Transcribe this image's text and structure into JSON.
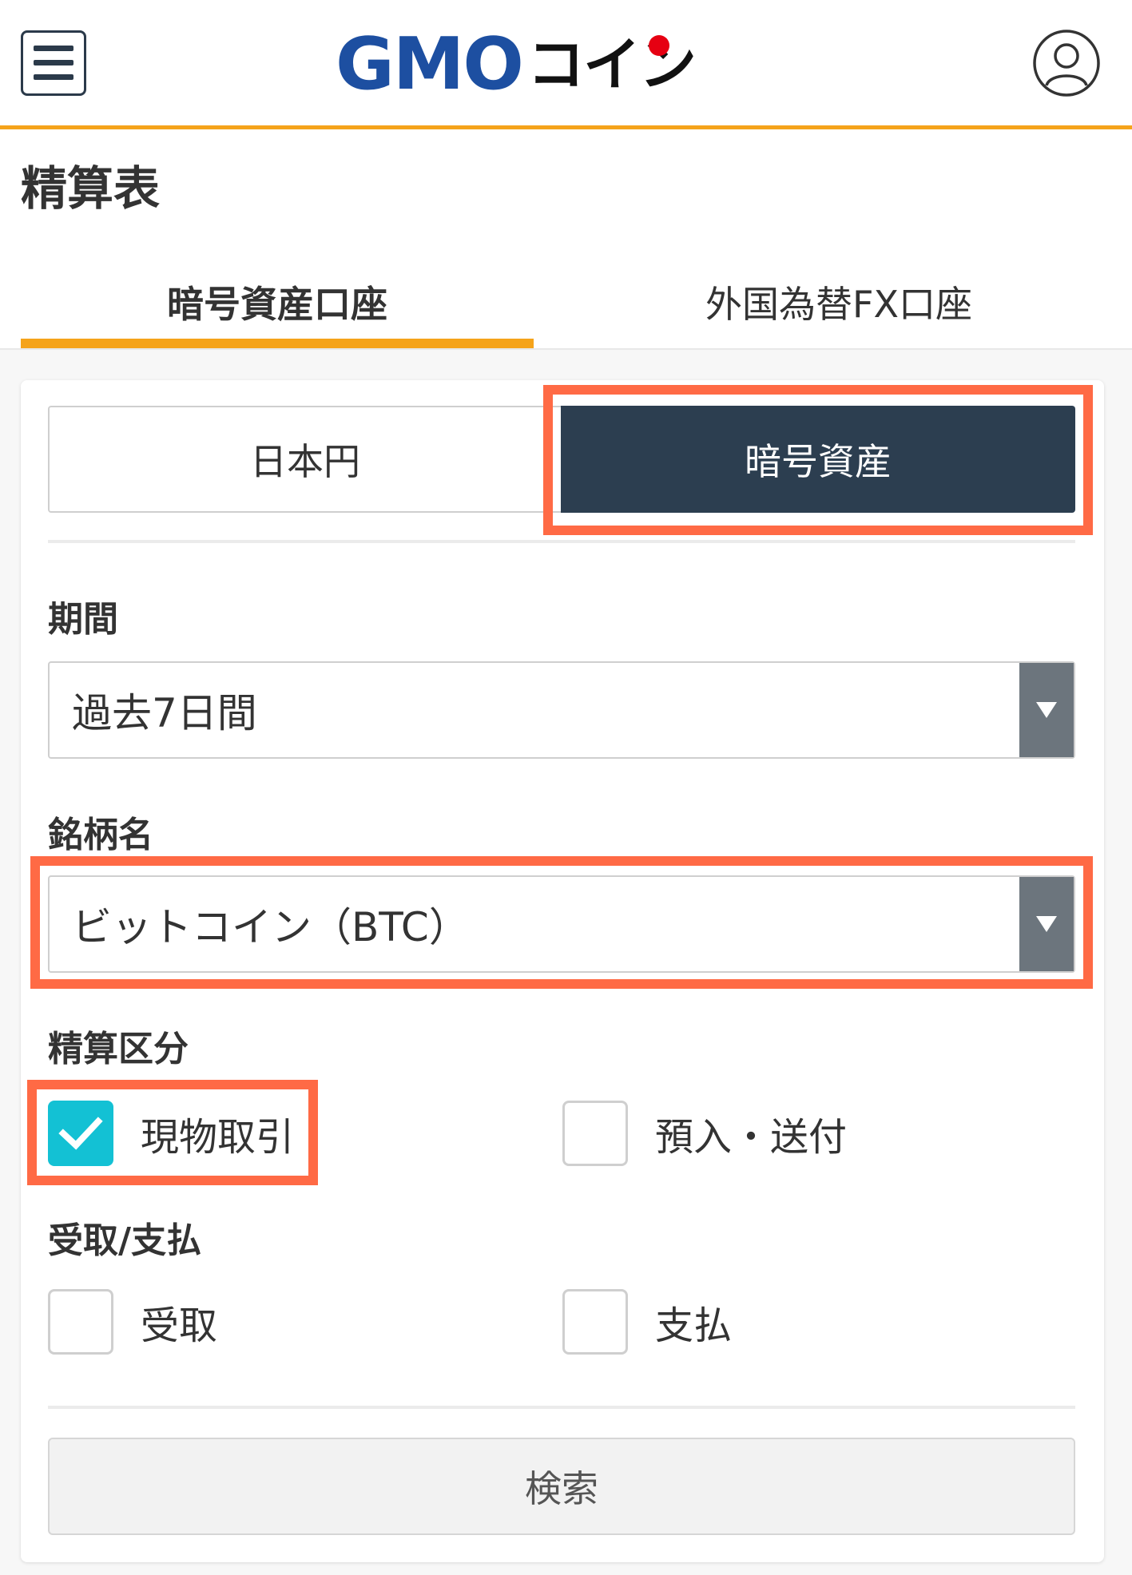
{
  "header": {
    "logo_gmo": "GMO",
    "logo_coin": "コイン"
  },
  "page": {
    "title": "精算表"
  },
  "tabs": {
    "crypto_account": "暗号資産口座",
    "fx_account": "外国為替FX口座"
  },
  "currency_toggle": {
    "jpy": "日本円",
    "crypto": "暗号資産",
    "selected": "crypto"
  },
  "period": {
    "label": "期間",
    "value": "過去7日間"
  },
  "symbol": {
    "label": "銘柄名",
    "value": "ビットコイン（BTC）"
  },
  "settlement_type": {
    "label": "精算区分",
    "options": [
      {
        "label": "現物取引",
        "checked": true
      },
      {
        "label": "預入・送付",
        "checked": false
      }
    ]
  },
  "receipt_payment": {
    "label": "受取/支払",
    "options": [
      {
        "label": "受取",
        "checked": false
      },
      {
        "label": "支払",
        "checked": false
      }
    ]
  },
  "search_button": "検索",
  "colors": {
    "accent": "#f5a31a",
    "dark": "#2c3e50",
    "check": "#13c1d4",
    "highlight": "#ff6a45",
    "logo_blue": "#1d4fa1",
    "logo_red": "#e60012"
  }
}
